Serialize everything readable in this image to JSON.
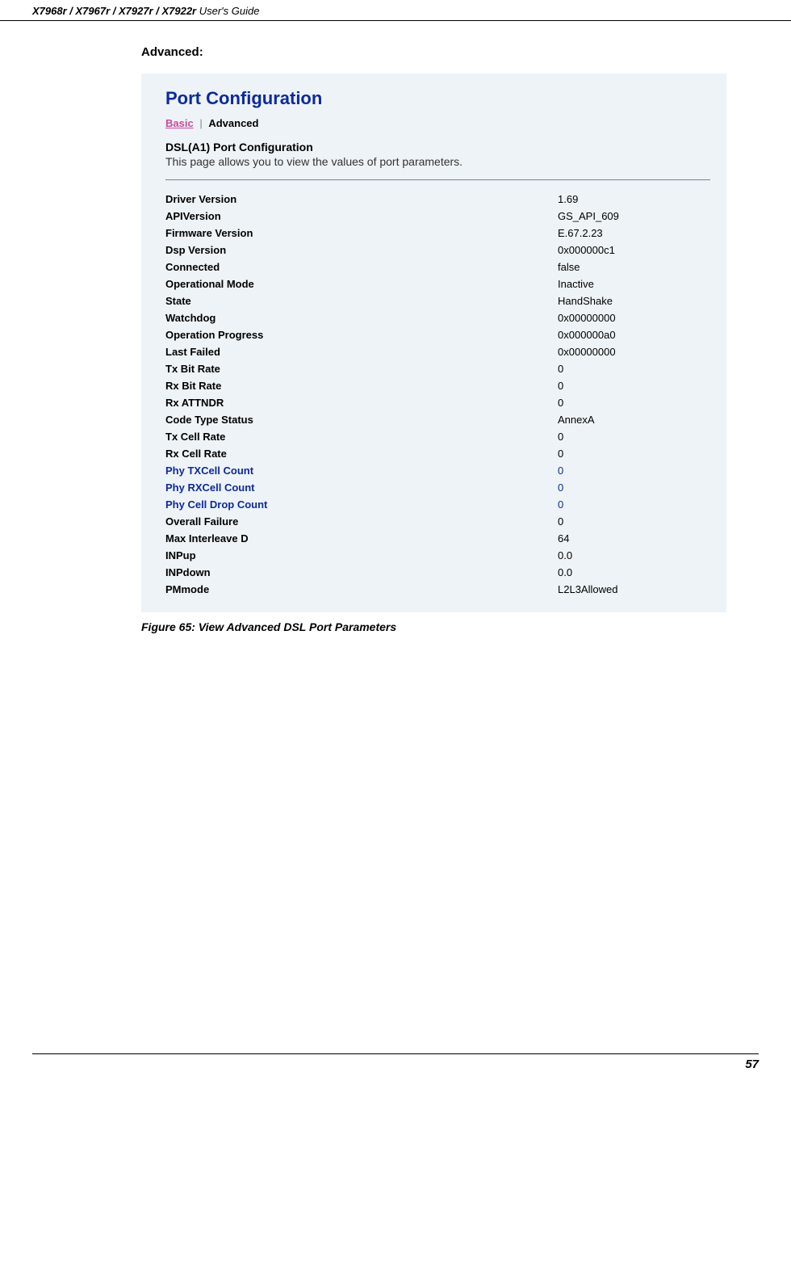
{
  "header": {
    "models": "X7968r / X7967r / X7927r / X7922r",
    "guide": " User's Guide"
  },
  "section_heading": "Advanced:",
  "panel": {
    "title": "Port Configuration",
    "tab_basic": "Basic",
    "tab_sep": "|",
    "tab_advanced": "Advanced",
    "subheading": "DSL(A1) Port Configuration",
    "description": "This page allows you to view the values of port parameters."
  },
  "params": [
    {
      "label": "Driver Version",
      "value": "1.69",
      "blue": false
    },
    {
      "label": "APIVersion",
      "value": "GS_API_609",
      "blue": false
    },
    {
      "label": "Firmware Version",
      "value": "E.67.2.23",
      "blue": false
    },
    {
      "label": "Dsp Version",
      "value": "0x000000c1",
      "blue": false
    },
    {
      "label": "Connected",
      "value": "false",
      "blue": false
    },
    {
      "label": "Operational Mode",
      "value": "Inactive",
      "blue": false
    },
    {
      "label": "State",
      "value": "HandShake",
      "blue": false
    },
    {
      "label": "Watchdog",
      "value": "0x00000000",
      "blue": false
    },
    {
      "label": "Operation Progress",
      "value": "0x000000a0",
      "blue": false
    },
    {
      "label": "Last Failed",
      "value": "0x00000000",
      "blue": false
    },
    {
      "label": "Tx Bit Rate",
      "value": "0",
      "blue": false
    },
    {
      "label": "Rx Bit Rate",
      "value": "0",
      "blue": false
    },
    {
      "label": "Rx ATTNDR",
      "value": "0",
      "blue": false
    },
    {
      "label": "Code Type Status",
      "value": "AnnexA",
      "blue": false
    },
    {
      "label": "Tx Cell Rate",
      "value": "0",
      "blue": false
    },
    {
      "label": "Rx Cell Rate",
      "value": "0",
      "blue": false
    },
    {
      "label": "Phy TXCell Count",
      "value": "0",
      "blue": true
    },
    {
      "label": "Phy RXCell Count",
      "value": "0",
      "blue": true
    },
    {
      "label": "Phy Cell Drop Count",
      "value": "0",
      "blue": true
    },
    {
      "label": "Overall Failure",
      "value": "0",
      "blue": false
    },
    {
      "label": "Max Interleave D",
      "value": "64",
      "blue": false
    },
    {
      "label": "INPup",
      "value": "0.0",
      "blue": false
    },
    {
      "label": "INPdown",
      "value": "0.0",
      "blue": false
    },
    {
      "label": "PMmode",
      "value": "L2L3Allowed",
      "blue": false
    }
  ],
  "figure_caption": "Figure 65: View Advanced DSL Port Parameters",
  "page_number": "57"
}
